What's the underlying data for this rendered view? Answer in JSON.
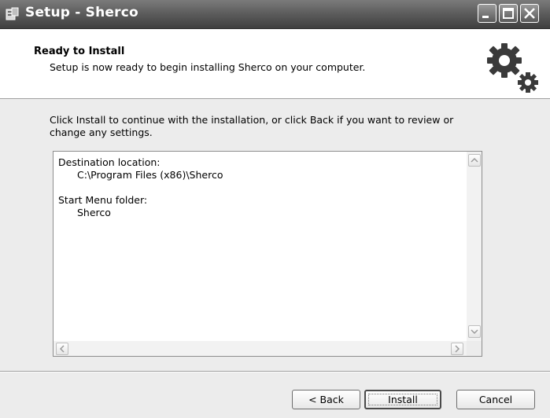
{
  "window": {
    "title": "Setup - Sherco",
    "icons": [
      "installer-app-icon",
      "minimize-icon",
      "maximize-icon",
      "close-icon"
    ]
  },
  "header": {
    "title": "Ready to Install",
    "subtitle": "Setup is now ready to begin installing Sherco on your computer.",
    "icon": "gears-icon"
  },
  "body": {
    "intro_line1": "Click Install to continue with the installation, or click Back if you want to review or",
    "intro_line2": "change any settings.",
    "memo": {
      "destination_label": "Destination location:",
      "destination_value": "C:\\Program Files (x86)\\Sherco",
      "startmenu_label": "Start Menu folder:",
      "startmenu_value": "Sherco"
    }
  },
  "buttons": {
    "back": "< Back",
    "install": "Install",
    "cancel": "Cancel"
  }
}
